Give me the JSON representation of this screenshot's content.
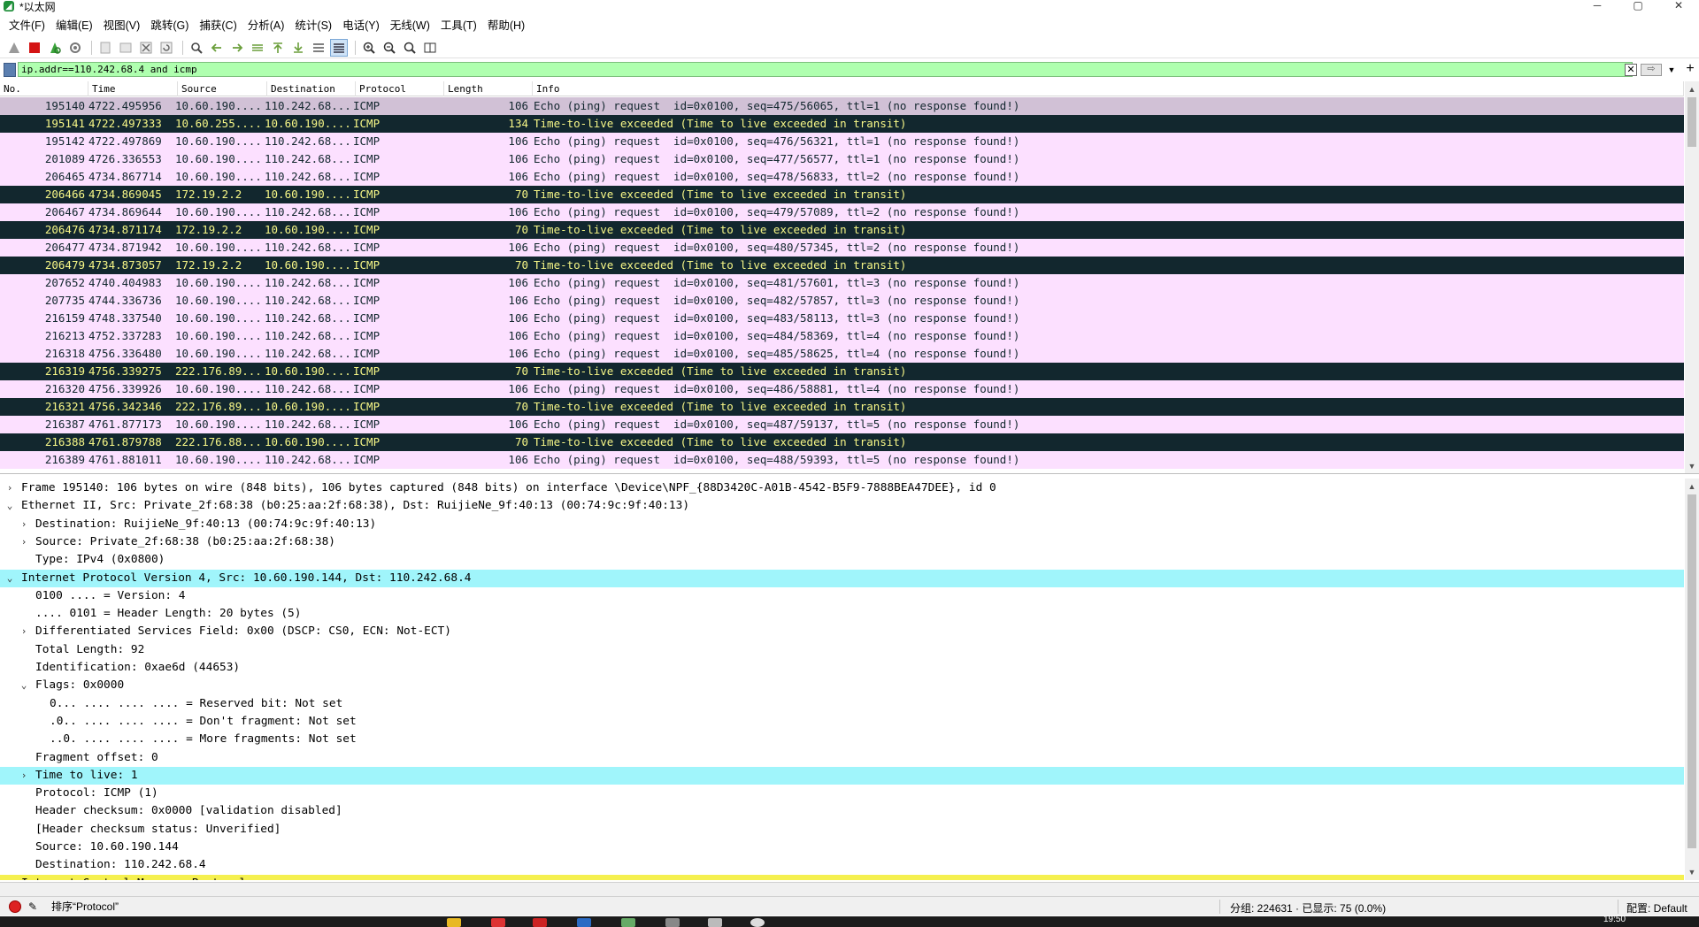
{
  "window": {
    "title": "*以太网",
    "controls": [
      "─",
      "▢",
      "✕"
    ]
  },
  "menu": [
    "文件(F)",
    "编辑(E)",
    "视图(V)",
    "跳转(G)",
    "捕获(C)",
    "分析(A)",
    "统计(S)",
    "电话(Y)",
    "无线(W)",
    "工具(T)",
    "帮助(H)"
  ],
  "filter": {
    "value": "ip.addr==110.242.68.4 and icmp"
  },
  "packet_list": {
    "columns": [
      "No.",
      "Time",
      "Source",
      "Destination",
      "Protocol",
      "Length",
      "Info"
    ],
    "rows": [
      {
        "type": "sel",
        "no": "195140",
        "time": "4722.495956",
        "src": "10.60.190....",
        "dst": "110.242.68...",
        "proto": "ICMP",
        "len": "106",
        "info": "Echo (ping) request  id=0x0100, seq=475/56065, ttl=1 (no response found!)"
      },
      {
        "type": "ttl",
        "no": "195141",
        "time": "4722.497333",
        "src": "10.60.255....",
        "dst": "10.60.190....",
        "proto": "ICMP",
        "len": "134",
        "info": "Time-to-live exceeded (Time to live exceeded in transit)"
      },
      {
        "type": "req",
        "no": "195142",
        "time": "4722.497869",
        "src": "10.60.190....",
        "dst": "110.242.68...",
        "proto": "ICMP",
        "len": "106",
        "info": "Echo (ping) request  id=0x0100, seq=476/56321, ttl=1 (no response found!)"
      },
      {
        "type": "req",
        "no": "201089",
        "time": "4726.336553",
        "src": "10.60.190....",
        "dst": "110.242.68...",
        "proto": "ICMP",
        "len": "106",
        "info": "Echo (ping) request  id=0x0100, seq=477/56577, ttl=1 (no response found!)"
      },
      {
        "type": "req",
        "no": "206465",
        "time": "4734.867714",
        "src": "10.60.190....",
        "dst": "110.242.68...",
        "proto": "ICMP",
        "len": "106",
        "info": "Echo (ping) request  id=0x0100, seq=478/56833, ttl=2 (no response found!)"
      },
      {
        "type": "ttl",
        "no": "206466",
        "time": "4734.869045",
        "src": "172.19.2.2",
        "dst": "10.60.190....",
        "proto": "ICMP",
        "len": "70",
        "info": "Time-to-live exceeded (Time to live exceeded in transit)"
      },
      {
        "type": "req",
        "no": "206467",
        "time": "4734.869644",
        "src": "10.60.190....",
        "dst": "110.242.68...",
        "proto": "ICMP",
        "len": "106",
        "info": "Echo (ping) request  id=0x0100, seq=479/57089, ttl=2 (no response found!)"
      },
      {
        "type": "ttl",
        "no": "206476",
        "time": "4734.871174",
        "src": "172.19.2.2",
        "dst": "10.60.190....",
        "proto": "ICMP",
        "len": "70",
        "info": "Time-to-live exceeded (Time to live exceeded in transit)"
      },
      {
        "type": "req",
        "no": "206477",
        "time": "4734.871942",
        "src": "10.60.190....",
        "dst": "110.242.68...",
        "proto": "ICMP",
        "len": "106",
        "info": "Echo (ping) request  id=0x0100, seq=480/57345, ttl=2 (no response found!)"
      },
      {
        "type": "ttl",
        "no": "206479",
        "time": "4734.873057",
        "src": "172.19.2.2",
        "dst": "10.60.190....",
        "proto": "ICMP",
        "len": "70",
        "info": "Time-to-live exceeded (Time to live exceeded in transit)"
      },
      {
        "type": "req",
        "no": "207652",
        "time": "4740.404983",
        "src": "10.60.190....",
        "dst": "110.242.68...",
        "proto": "ICMP",
        "len": "106",
        "info": "Echo (ping) request  id=0x0100, seq=481/57601, ttl=3 (no response found!)"
      },
      {
        "type": "req",
        "no": "207735",
        "time": "4744.336736",
        "src": "10.60.190....",
        "dst": "110.242.68...",
        "proto": "ICMP",
        "len": "106",
        "info": "Echo (ping) request  id=0x0100, seq=482/57857, ttl=3 (no response found!)"
      },
      {
        "type": "req",
        "no": "216159",
        "time": "4748.337540",
        "src": "10.60.190....",
        "dst": "110.242.68...",
        "proto": "ICMP",
        "len": "106",
        "info": "Echo (ping) request  id=0x0100, seq=483/58113, ttl=3 (no response found!)"
      },
      {
        "type": "req",
        "no": "216213",
        "time": "4752.337283",
        "src": "10.60.190....",
        "dst": "110.242.68...",
        "proto": "ICMP",
        "len": "106",
        "info": "Echo (ping) request  id=0x0100, seq=484/58369, ttl=4 (no response found!)"
      },
      {
        "type": "req",
        "no": "216318",
        "time": "4756.336480",
        "src": "10.60.190....",
        "dst": "110.242.68...",
        "proto": "ICMP",
        "len": "106",
        "info": "Echo (ping) request  id=0x0100, seq=485/58625, ttl=4 (no response found!)"
      },
      {
        "type": "ttl",
        "no": "216319",
        "time": "4756.339275",
        "src": "222.176.89...",
        "dst": "10.60.190....",
        "proto": "ICMP",
        "len": "70",
        "info": "Time-to-live exceeded (Time to live exceeded in transit)"
      },
      {
        "type": "req",
        "no": "216320",
        "time": "4756.339926",
        "src": "10.60.190....",
        "dst": "110.242.68...",
        "proto": "ICMP",
        "len": "106",
        "info": "Echo (ping) request  id=0x0100, seq=486/58881, ttl=4 (no response found!)"
      },
      {
        "type": "ttl",
        "no": "216321",
        "time": "4756.342346",
        "src": "222.176.89...",
        "dst": "10.60.190....",
        "proto": "ICMP",
        "len": "70",
        "info": "Time-to-live exceeded (Time to live exceeded in transit)"
      },
      {
        "type": "req",
        "no": "216387",
        "time": "4761.877173",
        "src": "10.60.190....",
        "dst": "110.242.68...",
        "proto": "ICMP",
        "len": "106",
        "info": "Echo (ping) request  id=0x0100, seq=487/59137, ttl=5 (no response found!)"
      },
      {
        "type": "ttl",
        "no": "216388",
        "time": "4761.879788",
        "src": "222.176.88...",
        "dst": "10.60.190....",
        "proto": "ICMP",
        "len": "70",
        "info": "Time-to-live exceeded (Time to live exceeded in transit)"
      },
      {
        "type": "req",
        "no": "216389",
        "time": "4761.881011",
        "src": "10.60.190....",
        "dst": "110.242.68...",
        "proto": "ICMP",
        "len": "106",
        "info": "Echo (ping) request  id=0x0100, seq=488/59393, ttl=5 (no response found!)"
      }
    ]
  },
  "details": [
    {
      "indent": 0,
      "arrow": ">",
      "hl": "",
      "text": "Frame 195140: 106 bytes on wire (848 bits), 106 bytes captured (848 bits) on interface \\Device\\NPF_{88D3420C-A01B-4542-B5F9-7888BEA47DEE}, id 0"
    },
    {
      "indent": 0,
      "arrow": "v",
      "hl": "",
      "text": "Ethernet II, Src: Private_2f:68:38 (b0:25:aa:2f:68:38), Dst: RuijieNe_9f:40:13 (00:74:9c:9f:40:13)"
    },
    {
      "indent": 1,
      "arrow": ">",
      "hl": "",
      "text": "Destination: RuijieNe_9f:40:13 (00:74:9c:9f:40:13)"
    },
    {
      "indent": 1,
      "arrow": ">",
      "hl": "",
      "text": "Source: Private_2f:68:38 (b0:25:aa:2f:68:38)"
    },
    {
      "indent": 1,
      "arrow": "",
      "hl": "",
      "text": "Type: IPv4 (0x0800)"
    },
    {
      "indent": 0,
      "arrow": "v",
      "hl": "cyan",
      "text": "Internet Protocol Version 4, Src: 10.60.190.144, Dst: 110.242.68.4"
    },
    {
      "indent": 1,
      "arrow": "",
      "hl": "",
      "text": "0100 .... = Version: 4"
    },
    {
      "indent": 1,
      "arrow": "",
      "hl": "",
      "text": ".... 0101 = Header Length: 20 bytes (5)"
    },
    {
      "indent": 1,
      "arrow": ">",
      "hl": "",
      "text": "Differentiated Services Field: 0x00 (DSCP: CS0, ECN: Not-ECT)"
    },
    {
      "indent": 1,
      "arrow": "",
      "hl": "",
      "text": "Total Length: 92"
    },
    {
      "indent": 1,
      "arrow": "",
      "hl": "",
      "text": "Identification: 0xae6d (44653)"
    },
    {
      "indent": 1,
      "arrow": "v",
      "hl": "",
      "text": "Flags: 0x0000"
    },
    {
      "indent": 2,
      "arrow": "",
      "hl": "",
      "text": "0... .... .... .... = Reserved bit: Not set"
    },
    {
      "indent": 2,
      "arrow": "",
      "hl": "",
      "text": ".0.. .... .... .... = Don't fragment: Not set"
    },
    {
      "indent": 2,
      "arrow": "",
      "hl": "",
      "text": "..0. .... .... .... = More fragments: Not set"
    },
    {
      "indent": 1,
      "arrow": "",
      "hl": "",
      "text": "Fragment offset: 0"
    },
    {
      "indent": 1,
      "arrow": ">",
      "hl": "cyan",
      "text": "Time to live: 1"
    },
    {
      "indent": 1,
      "arrow": "",
      "hl": "",
      "text": "Protocol: ICMP (1)"
    },
    {
      "indent": 1,
      "arrow": "",
      "hl": "",
      "text": "Header checksum: 0x0000 [validation disabled]"
    },
    {
      "indent": 1,
      "arrow": "",
      "hl": "",
      "text": "[Header checksum status: Unverified]"
    },
    {
      "indent": 1,
      "arrow": "",
      "hl": "",
      "text": "Source: 10.60.190.144"
    },
    {
      "indent": 1,
      "arrow": "",
      "hl": "",
      "text": "Destination: 110.242.68.4"
    },
    {
      "indent": 0,
      "arrow": ">",
      "hl": "yellow",
      "text": "Internet Control Message Protocol"
    }
  ],
  "status": {
    "sort_text": "排序“Protocol”",
    "counts": "分组: 224631 · 已显示: 75 (0.0%)",
    "profile": "配置: Default"
  },
  "taskbar": {
    "clock": "19:50"
  },
  "colors": {
    "request_bg": "#fce0ff",
    "selected_bg": "#d1c1d6",
    "ttl_bg": "#12272e",
    "ttl_fg": "#f7f787",
    "filter_ok": "#afffaf",
    "detail_cyan": "#a0f5fb",
    "detail_yellow": "#f5f04f"
  }
}
